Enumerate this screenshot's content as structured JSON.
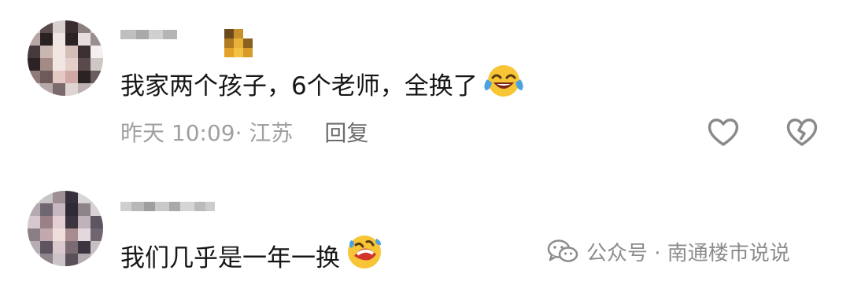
{
  "comments": [
    {
      "text": "我家两个孩子，6个老师，全换了",
      "emoji": "laughing-tears-emoji",
      "time": "昨天 10:09",
      "location": "· 江苏",
      "reply_label": "回复",
      "icons": {
        "like": "heart-outline-icon",
        "dislike": "broken-heart-icon"
      }
    },
    {
      "text": "我们几乎是一年一换",
      "emoji": "rolling-laughing-emoji"
    }
  ],
  "watermark": {
    "icon": "wechat-icon",
    "text": "公众号 · 南通楼市说说"
  }
}
